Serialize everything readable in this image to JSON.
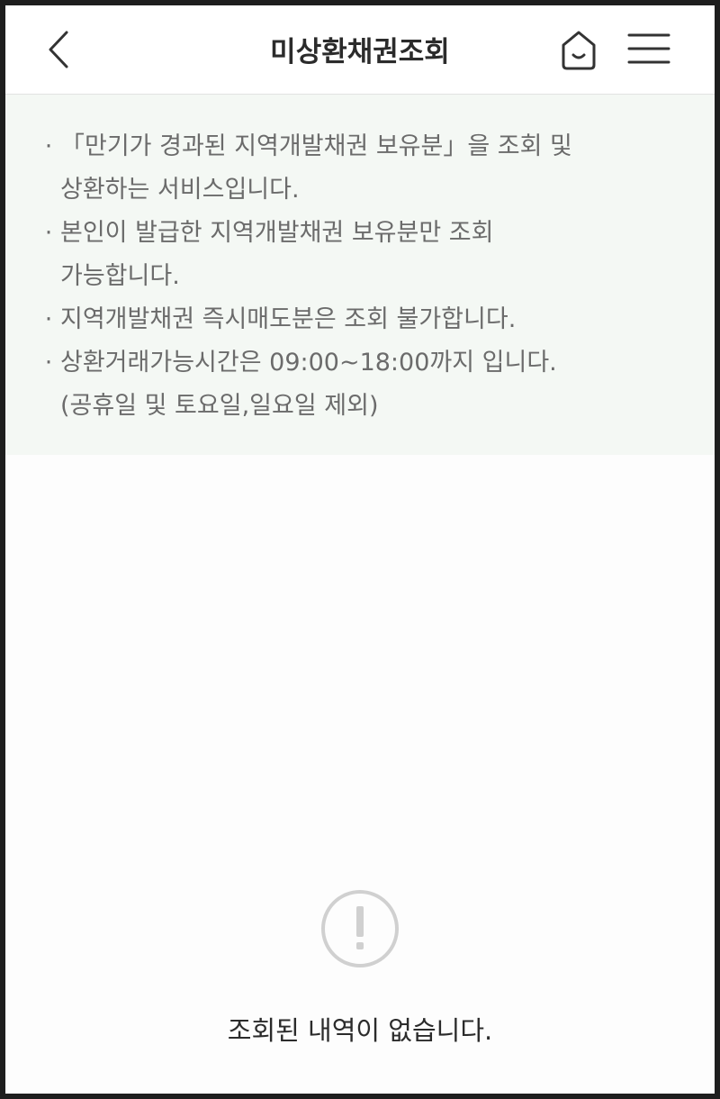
{
  "header": {
    "title": "미상환채권조회",
    "back_icon": "chevron-left-icon",
    "home_icon": "home-icon",
    "menu_icon": "hamburger-menu-icon"
  },
  "notice": {
    "bullet": "·",
    "items": [
      {
        "text": "「만기가 경과된 지역개발채권 보유분」을 조회 및\n상환하는 서비스입니다."
      },
      {
        "text": "본인이 발급한 지역개발채권 보유분만 조회\n가능합니다."
      },
      {
        "text": "지역개발채권 즉시매도분은 조회 불가합니다."
      },
      {
        "text": "상환거래가능시간은 09:00~18:00까지 입니다.\n(공휴일 및 토요일,일요일 제외)"
      }
    ]
  },
  "empty_state": {
    "icon": "exclamation-circle-icon",
    "message": "조회된 내역이 없습니다."
  },
  "colors": {
    "notice_background": "#f4f8f4",
    "title_text": "#2b2b2b",
    "notice_text": "#6b6b6b",
    "icon_gray": "#d0d0d0"
  }
}
